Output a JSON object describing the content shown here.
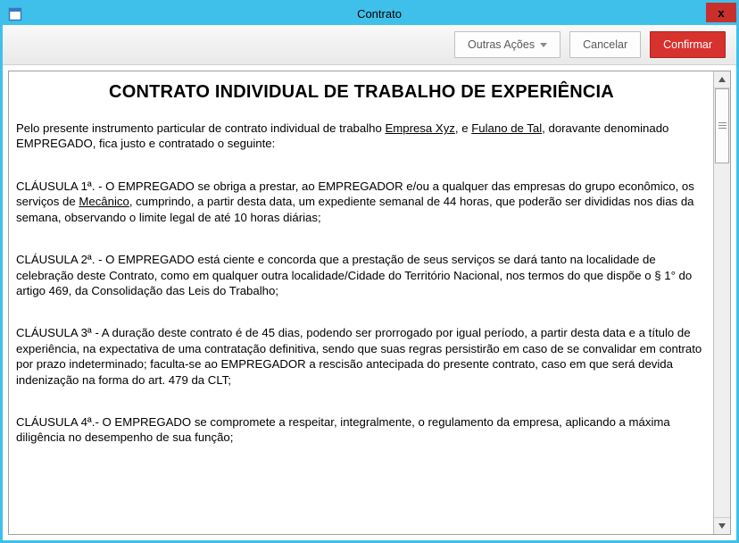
{
  "window": {
    "title": "Contrato",
    "close_label": "x"
  },
  "toolbar": {
    "other_actions_label": "Outras Ações",
    "cancel_label": "Cancelar",
    "confirm_label": "Confirmar"
  },
  "document": {
    "title": "CONTRATO INDIVIDUAL DE TRABALHO DE EXPERIÊNCIA",
    "intro_a": "Pelo presente instrumento particular de contrato individual de trabalho ",
    "intro_company": "Empresa Xyz",
    "intro_b": ", e ",
    "intro_employee": "Fulano de Tal",
    "intro_c": ", doravante denominado EMPREGADO, fica justo e contratado o seguinte:",
    "c1_a": "CLÁUSULA 1ª. - O EMPREGADO se obriga a prestar, ao EMPREGADOR e/ou a qualquer das empresas do grupo econômico, os serviços de ",
    "c1_role": "Mecânico",
    "c1_b": ", cumprindo, a partir desta data, um expediente semanal de 44 horas, que poderão ser divididas nos dias da semana, observando o limite legal de até 10 horas diárias;",
    "c2": "CLÁUSULA 2ª. - O EMPREGADO está ciente e concorda que a prestação de seus serviços se dará tanto na localidade de celebração deste Contrato, como em qualquer outra localidade/Cidade do Território Nacional, nos termos do que dispõe o § 1° do artigo 469, da Consolidação das Leis do Trabalho;",
    "c3": "CLÁUSULA 3ª - A duração deste contrato é de 45 dias, podendo ser prorrogado por igual período, a partir desta data e a título de experiência, na expectativa de uma contratação definitiva, sendo que suas regras persistirão em caso de se convalidar em contrato por prazo indeterminado; faculta-se ao EMPREGADOR a rescisão antecipada do presente contrato, caso em que será devida indenização na forma do art. 479 da CLT;",
    "c4": "CLÁUSULA 4ª.- O EMPREGADO se compromete a respeitar, integralmente, o regulamento da empresa, aplicando a máxima diligência no desempenho de sua função;"
  }
}
